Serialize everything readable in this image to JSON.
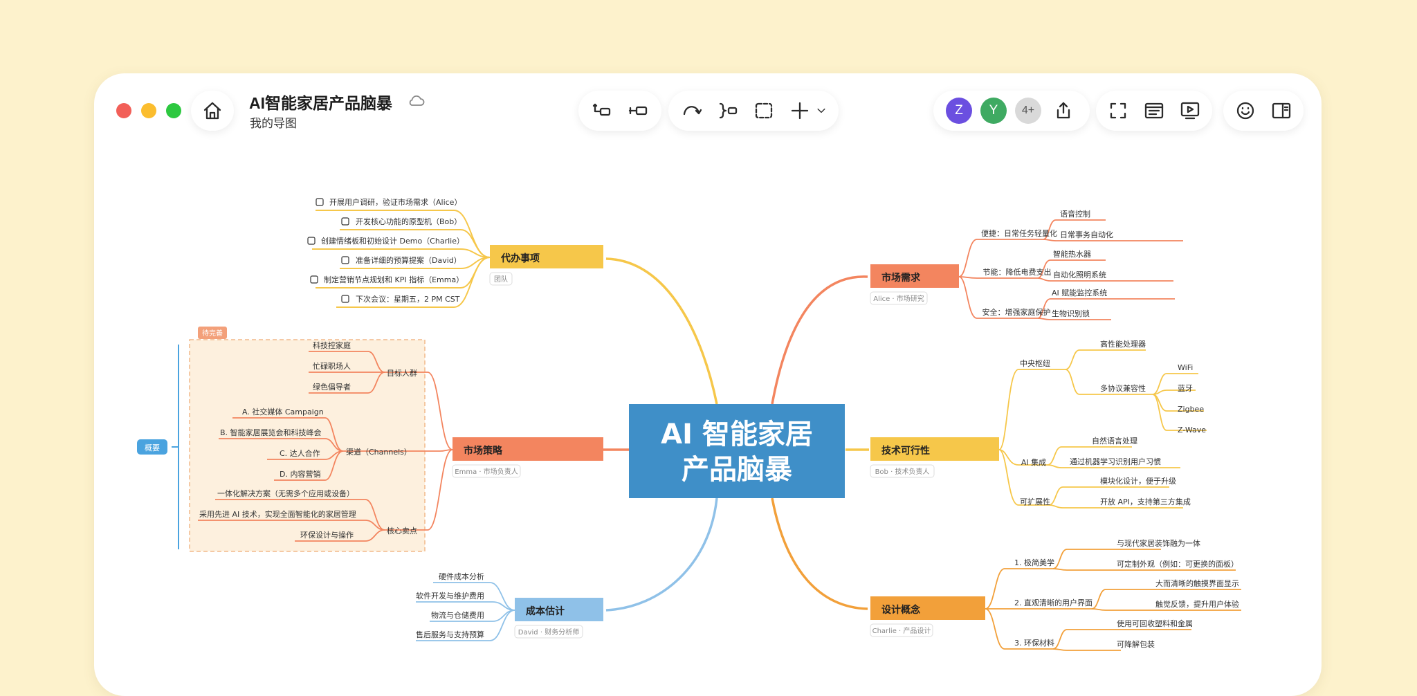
{
  "document": {
    "title": "AI智能家居产品脑暴",
    "subtitle": "我的导图"
  },
  "toolbar": {
    "left_tools": [
      "insert-child-icon",
      "insert-sibling-icon"
    ],
    "mid_tools": [
      "relationship-icon",
      "summary-icon",
      "boundary-icon",
      "insert-icon",
      "chevron-down-icon"
    ],
    "collaborators": [
      {
        "label": "Z",
        "color": "#6b4fe0"
      },
      {
        "label": "Y",
        "color": "#3faa62"
      },
      {
        "label": "4+",
        "color": "#d8d8d8"
      }
    ],
    "right_tools": [
      "fullscreen-icon",
      "outline-icon",
      "present-icon",
      "emoji-icon",
      "sidebar-icon"
    ]
  },
  "colors": {
    "background": "#fdf2cc",
    "central": "#3f8fc8",
    "yellow": "#f6c74a",
    "orange_red": "#f3855f",
    "orange": "#f2a03a",
    "blue": "#8fc1e8"
  },
  "mindmap": {
    "central": {
      "line1": "AI 智能家居",
      "line2": "产品脑暴"
    },
    "todo": {
      "title": "代办事项",
      "tag": "团队",
      "items": [
        "开展用户调研，验证市场需求（Alice）",
        "开发核心功能的原型机（Bob）",
        "创建情绪板和初始设计 Demo（Charlie）",
        "准备详细的预算提案（David）",
        "制定营销节点规划和 KPI 指标（Emma）",
        "下次会议：星期五，2 PM CST"
      ]
    },
    "market_strategy": {
      "title": "市场策略",
      "tag": "Emma · 市场负责人",
      "boundary_label": "待完善",
      "summary_label": "概要",
      "groups": [
        {
          "label": "目标人群",
          "items": [
            "科技控家庭",
            "忙碌职场人",
            "绿色倡导者"
          ]
        },
        {
          "label": "渠道（Channels）",
          "items": [
            "A. 社交媒体 Campaign",
            "B. 智能家居展览会和科技峰会",
            "C. 达人合作",
            "D. 内容营销"
          ]
        },
        {
          "label": "核心卖点",
          "items": [
            "一体化解决方案（无需多个应用或设备）",
            "采用先进 AI 技术，实现全面智能化的家居管理",
            "环保设计与操作"
          ]
        }
      ]
    },
    "cost": {
      "title": "成本估计",
      "tag": "David · 财务分析师",
      "items": [
        "硬件成本分析",
        "软件开发与维护费用",
        "物流与仓储费用",
        "售后服务与支持预算"
      ]
    },
    "market_demand": {
      "title": "市场需求",
      "tag": "Alice · 市场研究",
      "groups": [
        {
          "label": "便捷：日常任务轻量化",
          "items": [
            "语音控制",
            "日常事务自动化"
          ]
        },
        {
          "label": "节能：降低电费支出",
          "items": [
            "智能热水器",
            "自动化照明系统"
          ]
        },
        {
          "label": "安全：增强家庭保护",
          "items": [
            "AI 赋能监控系统",
            "生物识别锁"
          ]
        }
      ]
    },
    "tech": {
      "title": "技术可行性",
      "tag": "Bob · 技术负责人",
      "hub": {
        "label": "中央枢纽",
        "processor": "高性能处理器",
        "protocol": "多协议兼容性",
        "protocols": [
          "WiFi",
          "蓝牙",
          "Zigbee",
          "Z-Wave"
        ]
      },
      "ai": {
        "label": "AI 集成",
        "items": [
          "自然语言处理",
          "通过机器学习识别用户习惯"
        ]
      },
      "ext": {
        "label": "可扩展性",
        "items": [
          "模块化设计，便于升级",
          "开放 API，支持第三方集成"
        ]
      }
    },
    "design": {
      "title": "设计概念",
      "tag": "Charlie · 产品设计",
      "groups": [
        {
          "label": "1. 极简美学",
          "items": [
            "与现代家居装饰融为一体",
            "可定制外观（例如：可更换的面板）"
          ]
        },
        {
          "label": "2. 直观清晰的用户界面",
          "items": [
            "大而清晰的触摸界面显示",
            "触觉反馈，提升用户体验"
          ]
        },
        {
          "label": "3. 环保材料",
          "items": [
            "使用可回收塑料和金属",
            "可降解包装"
          ]
        }
      ]
    }
  }
}
